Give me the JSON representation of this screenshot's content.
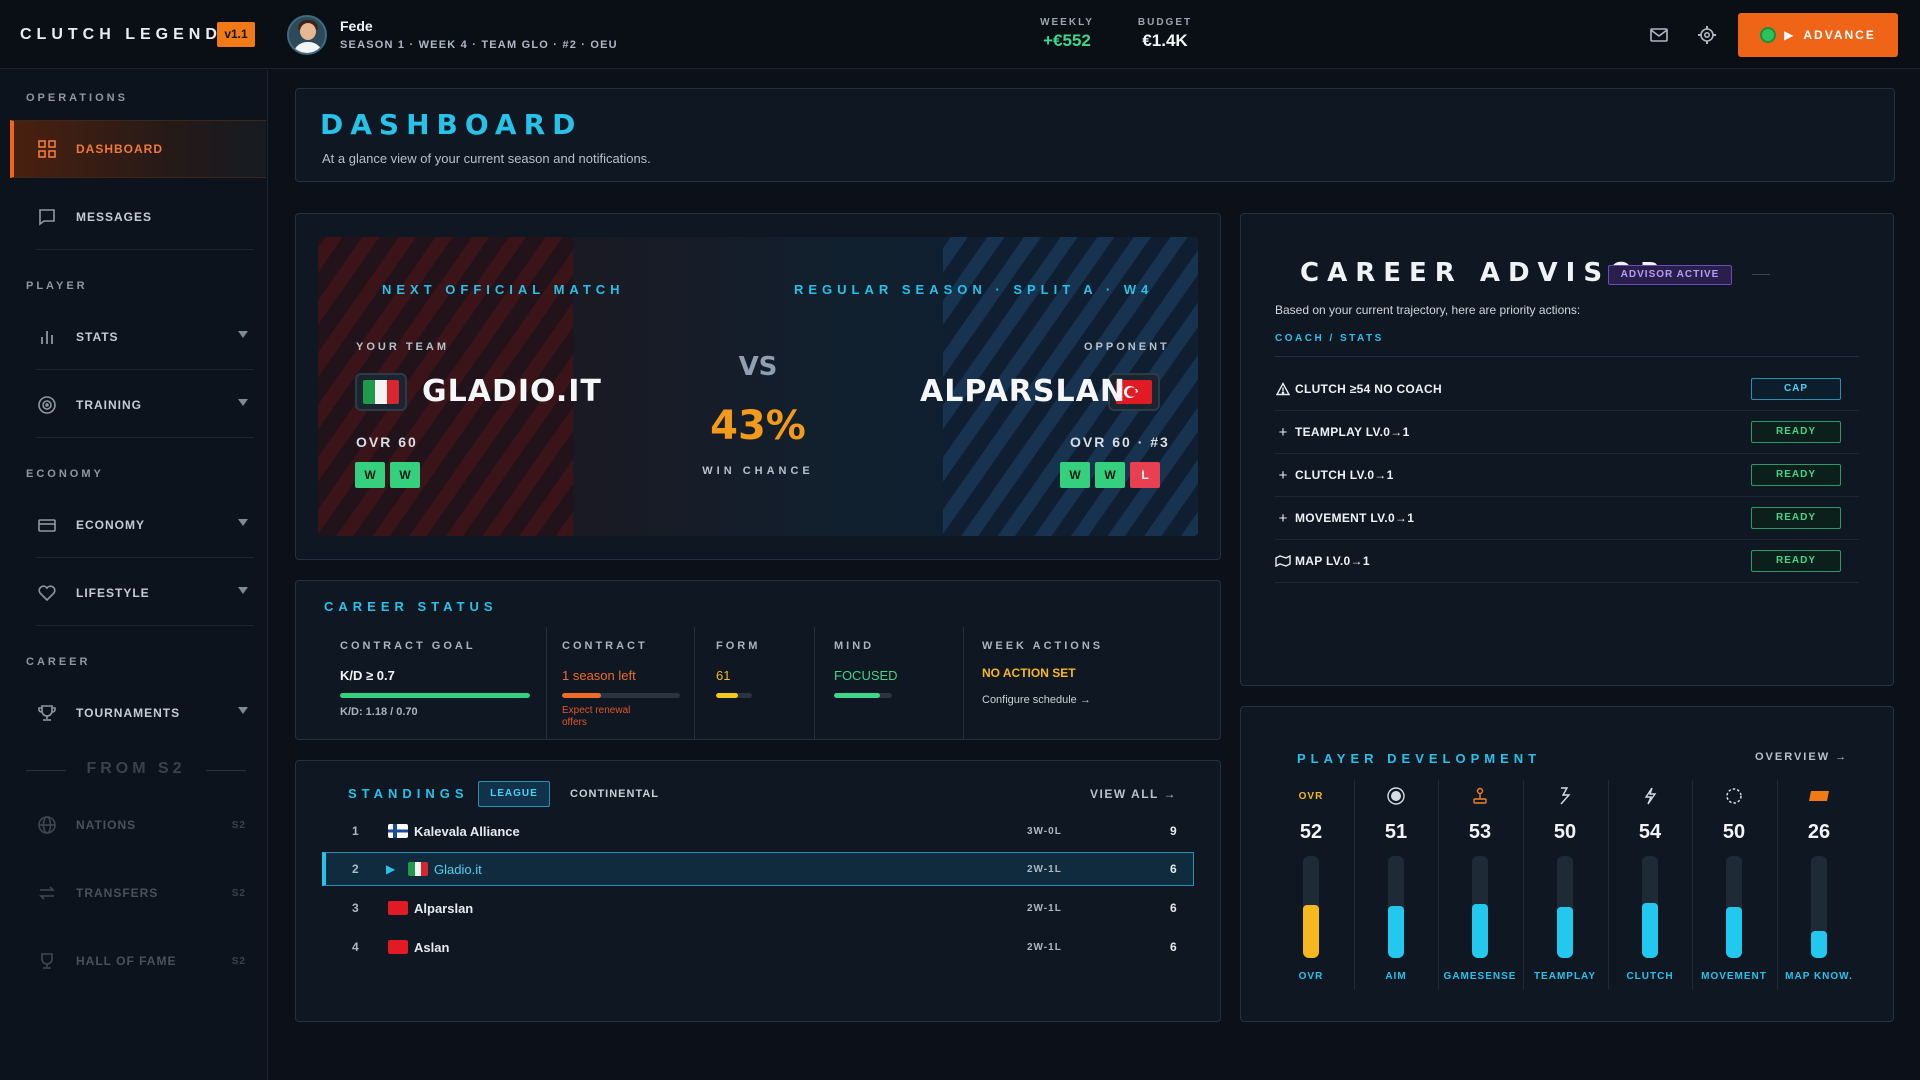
{
  "app": {
    "brand": "CLUTCH LEGEND",
    "version": "v1.1"
  },
  "player": {
    "name": "Fede",
    "subtitle": "SEASON 1 · WEEK 4 · TEAM GLO · #2 · OEU"
  },
  "finance": {
    "weekly_label": "WEEKLY",
    "weekly_value": "+€552",
    "budget_label": "BUDGET",
    "budget_value": "€1.4K"
  },
  "header": {
    "advance_label": "ADVANCE",
    "mail_icon": "mail-icon",
    "settings_icon": "gear-icon"
  },
  "sidebar": {
    "sections": [
      "OPERATIONS",
      "PLAYER",
      "ECONOMY",
      "CAREER"
    ],
    "items": [
      {
        "label": "DASHBOARD",
        "icon": "grid-icon",
        "active": true
      },
      {
        "label": "MESSAGES",
        "icon": "chat-icon"
      },
      {
        "label": "STATS",
        "icon": "bar-chart-icon",
        "expandable": true
      },
      {
        "label": "TRAINING",
        "icon": "target-icon",
        "expandable": true
      },
      {
        "label": "ECONOMY",
        "icon": "wallet-icon",
        "expandable": true
      },
      {
        "label": "LIFESTYLE",
        "icon": "heart-icon",
        "expandable": true
      },
      {
        "label": "TOURNAMENTS",
        "icon": "trophy-icon",
        "expandable": true
      },
      {
        "label": "NATIONS",
        "icon": "globe-icon",
        "locked": "S2"
      },
      {
        "label": "TRANSFERS",
        "icon": "transfer-icon",
        "locked": "S2"
      },
      {
        "label": "HALL OF FAME",
        "icon": "trophy-icon",
        "locked": "S2"
      }
    ],
    "divider_label": "FROM S2"
  },
  "dashboard": {
    "title": "DASHBOARD",
    "subtitle": "At a glance view of your current season and notifications."
  },
  "match": {
    "next_label": "NEXT OFFICIAL MATCH",
    "season_label": "REGULAR SEASON · SPLIT A · W4",
    "home": {
      "label": "YOUR TEAM",
      "name": "GLADIO.IT",
      "ovr": "OVR 60",
      "form": [
        "W",
        "W"
      ]
    },
    "away": {
      "label": "OPPONENT",
      "name": "ALPARSLAN",
      "ovr": "OVR 60 · #3",
      "form": [
        "W",
        "W",
        "L"
      ]
    },
    "vs": "VS",
    "win_chance": "43%",
    "win_label": "WIN CHANCE"
  },
  "career_status": {
    "title": "CAREER STATUS",
    "contract_goal": {
      "label": "CONTRACT GOAL",
      "value": "K/D ≥ 0.7",
      "detail": "K/D: 1.18 / 0.70",
      "progress": 1.0
    },
    "contract": {
      "label": "CONTRACT",
      "value": "1 season left",
      "note": "Expect renewal offers",
      "progress": 0.33
    },
    "form": {
      "label": "FORM",
      "value": "61",
      "progress": 0.61
    },
    "mind": {
      "label": "MIND",
      "value": "FOCUSED",
      "progress": 0.8
    },
    "week_actions": {
      "label": "WEEK ACTIONS",
      "value": "NO ACTION SET",
      "link": "Configure schedule →"
    }
  },
  "standings": {
    "title": "STANDINGS",
    "tabs": [
      "LEAGUE",
      "CONTINENTAL"
    ],
    "view_all": "VIEW ALL →",
    "rows": [
      {
        "rank": "1",
        "team": "Kalevala Alliance",
        "record": "3W-0L",
        "points": "9",
        "flag": "fi"
      },
      {
        "rank": "2",
        "team": "Gladio.it",
        "record": "2W-1L",
        "points": "6",
        "flag": "it",
        "me": true
      },
      {
        "rank": "3",
        "team": "Alparslan",
        "record": "2W-1L",
        "points": "6",
        "flag": "tr"
      },
      {
        "rank": "4",
        "team": "Aslan",
        "record": "2W-1L",
        "points": "6",
        "flag": "tr"
      }
    ]
  },
  "advisor": {
    "title": "CAREER ADVISOR",
    "badge": "ADVISOR ACTIVE",
    "description": "Based on your current trajectory, here are priority actions:",
    "link": "COACH / STATS",
    "actions": [
      {
        "icon": "warning-icon",
        "label": "CLUTCH ≥54 NO COACH",
        "button": "CAP"
      },
      {
        "icon": "plus-icon",
        "label": "TEAMPLAY LV.0→1",
        "button": "READY"
      },
      {
        "icon": "plus-icon",
        "label": "CLUTCH LV.0→1",
        "button": "READY"
      },
      {
        "icon": "plus-icon",
        "label": "MOVEMENT LV.0→1",
        "button": "READY"
      },
      {
        "icon": "map-icon",
        "label": "MAP LV.0→1",
        "button": "READY"
      }
    ]
  },
  "development": {
    "title": "PLAYER DEVELOPMENT",
    "overview": "OVERVIEW →",
    "ovr_tag": "OVR",
    "stats": [
      {
        "label": "OVR",
        "value": "52",
        "level": 0.52,
        "color": "#f5b81f",
        "icon": "ovr-tag"
      },
      {
        "label": "AIM",
        "value": "51",
        "level": 0.51,
        "color": "#22c8ee",
        "icon": "crosshair-icon"
      },
      {
        "label": "GAMESENSE",
        "value": "53",
        "level": 0.53,
        "color": "#22c8ee",
        "icon": "joystick-icon"
      },
      {
        "label": "TEAMPLAY",
        "value": "50",
        "level": 0.5,
        "color": "#22c8ee",
        "icon": "link-icon"
      },
      {
        "label": "CLUTCH",
        "value": "54",
        "level": 0.54,
        "color": "#22c8ee",
        "icon": "bolt-icon"
      },
      {
        "label": "MOVEMENT",
        "value": "50",
        "level": 0.5,
        "color": "#22c8ee",
        "icon": "circle-dashed-icon"
      },
      {
        "label": "MAP KNOW.",
        "value": "26",
        "level": 0.26,
        "color": "#22c8ee",
        "icon": "map-flag-icon"
      }
    ]
  }
}
